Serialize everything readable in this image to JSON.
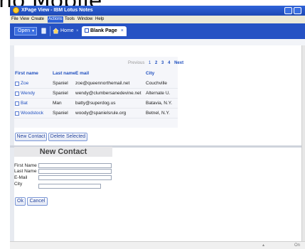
{
  "banner": {
    "text": "no Mobile"
  },
  "window": {
    "title": "XPage View - IBM Lotus Notes"
  },
  "menu": [
    "File",
    "View",
    "Create",
    "Actions",
    "Tools",
    "Window",
    "Help"
  ],
  "menu_active_index": 3,
  "toolbar": {
    "open_label": "Open",
    "tabs": [
      {
        "label": "Home"
      },
      {
        "label": "Blank Page"
      }
    ]
  },
  "pager": {
    "previous": "Previous",
    "pages": [
      "1",
      "2",
      "3",
      "4"
    ],
    "next": "Next"
  },
  "table": {
    "headers": [
      "First name",
      "Last name",
      "E mail",
      "City"
    ],
    "rows": [
      [
        "Zoe",
        "Spaniel",
        "zoe@queennorthemail.net",
        "Couchville"
      ],
      [
        "Wendy",
        "Spaniel",
        "wendy@clumbersanedevine.net",
        "Alternate U."
      ],
      [
        "Bat",
        "Man",
        "batty@superdog.us",
        "Batavia, N.Y."
      ],
      [
        "Woodstock",
        "Spaniel",
        "woody@spanielsrule.org",
        "Betnel, N.Y."
      ]
    ]
  },
  "actions": {
    "new_contact": "New Contact",
    "delete_selected": "Delete Selected"
  },
  "form": {
    "title": "New Contact",
    "fields": [
      {
        "label": "First Name",
        "value": ""
      },
      {
        "label": "Last Name",
        "value": ""
      },
      {
        "label": "E-Mail",
        "value": ""
      },
      {
        "label": "City",
        "value": ""
      }
    ],
    "ok": "Ok",
    "cancel": "Cancel"
  },
  "status": {
    "text": "On"
  },
  "colors": {
    "titlebar": "#2f63d8",
    "tabbar": "#2652c4",
    "link": "#1f4fbf",
    "menubar": "#ece9d8"
  }
}
